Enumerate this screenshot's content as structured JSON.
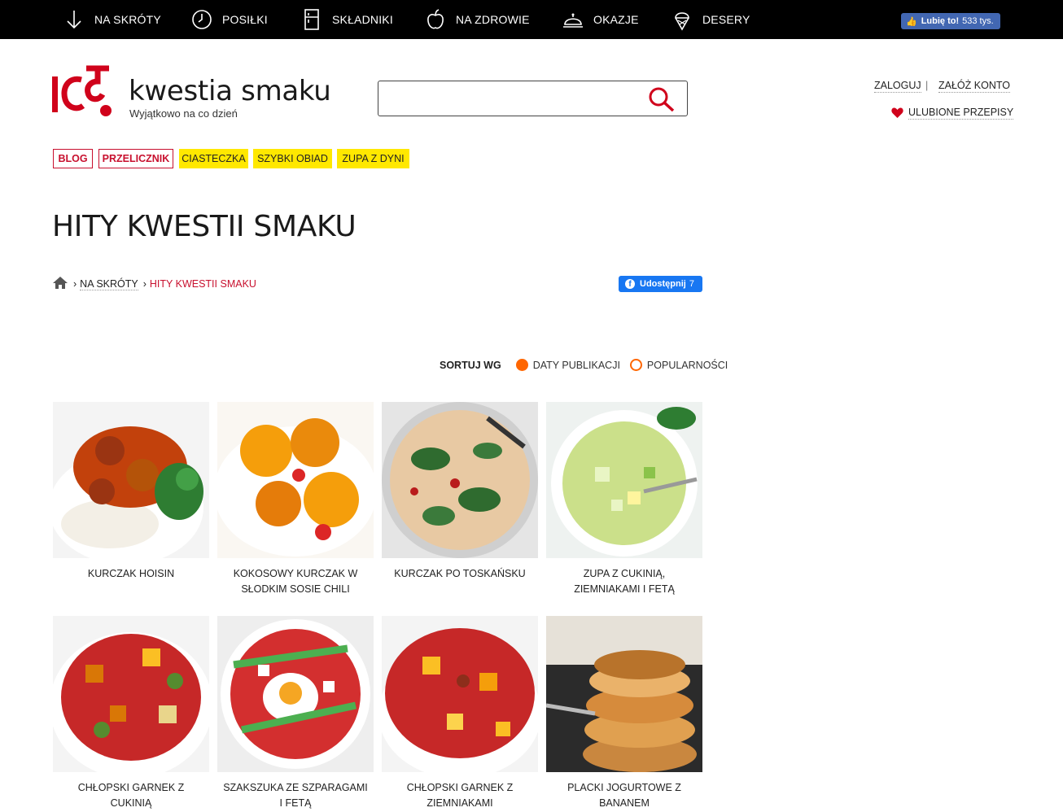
{
  "topnav": {
    "items": [
      {
        "label": "NA SKRÓTY",
        "icon": "arrow-down-icon"
      },
      {
        "label": "POSIŁKI",
        "icon": "clock-icon"
      },
      {
        "label": "SKŁADNIKI",
        "icon": "fridge-icon"
      },
      {
        "label": "NA ZDROWIE",
        "icon": "apple-icon"
      },
      {
        "label": "OKAZJE",
        "icon": "cloche-icon"
      },
      {
        "label": "DESERY",
        "icon": "ice-cream-icon"
      }
    ],
    "fb_like": {
      "label": "Lubię to!",
      "count": "533 tys."
    }
  },
  "header": {
    "brand": "kwestia smaku",
    "tagline": "Wyjątkowo na co dzień",
    "search": {
      "value": "",
      "placeholder": ""
    },
    "login": "ZALOGUJ",
    "separator": "|",
    "register": "ZAŁÓŻ KONTO",
    "favorites": "ULUBIONE PRZEPISY"
  },
  "tags": [
    "BLOG",
    "PRZELICZNIK",
    "CIASTECZKA",
    "SZYBKI OBIAD",
    "ZUPA Z DYNI"
  ],
  "page_title": "HITY KWESTII SMAKU",
  "breadcrumb": {
    "sep": "›",
    "parent": "NA SKRÓTY",
    "current": "HITY KWESTII SMAKU"
  },
  "share": {
    "label": "Udostępnij",
    "count": "7"
  },
  "sort": {
    "label": "SORTUJ WG",
    "options": [
      {
        "label": "DATY PUBLIKACJI",
        "selected": true
      },
      {
        "label": "POPULARNOŚCI",
        "selected": false
      }
    ]
  },
  "recipes": [
    {
      "title": "KURCZAK HOISIN"
    },
    {
      "title": "KOKOSOWY KURCZAK W SŁODKIM SOSIE CHILI"
    },
    {
      "title": "KURCZAK PO TOSKAŃSKU"
    },
    {
      "title": "ZUPA Z CUKINIĄ, ZIEMNIAKAMI I FETĄ"
    },
    {
      "title": "CHŁOPSKI GARNEK Z CUKINIĄ"
    },
    {
      "title": "SZAKSZUKA ZE SZPARAGAMI I FETĄ"
    },
    {
      "title": "CHŁOPSKI GARNEK Z ZIEMNIAKAMI"
    },
    {
      "title": "PLACKI JOGURTOWE Z BANANEM"
    }
  ],
  "colors": {
    "accent_red": "#c8102e",
    "tag_yellow": "#ffe800",
    "sort_orange": "#ff6600",
    "fb_blue": "#1877f2"
  }
}
